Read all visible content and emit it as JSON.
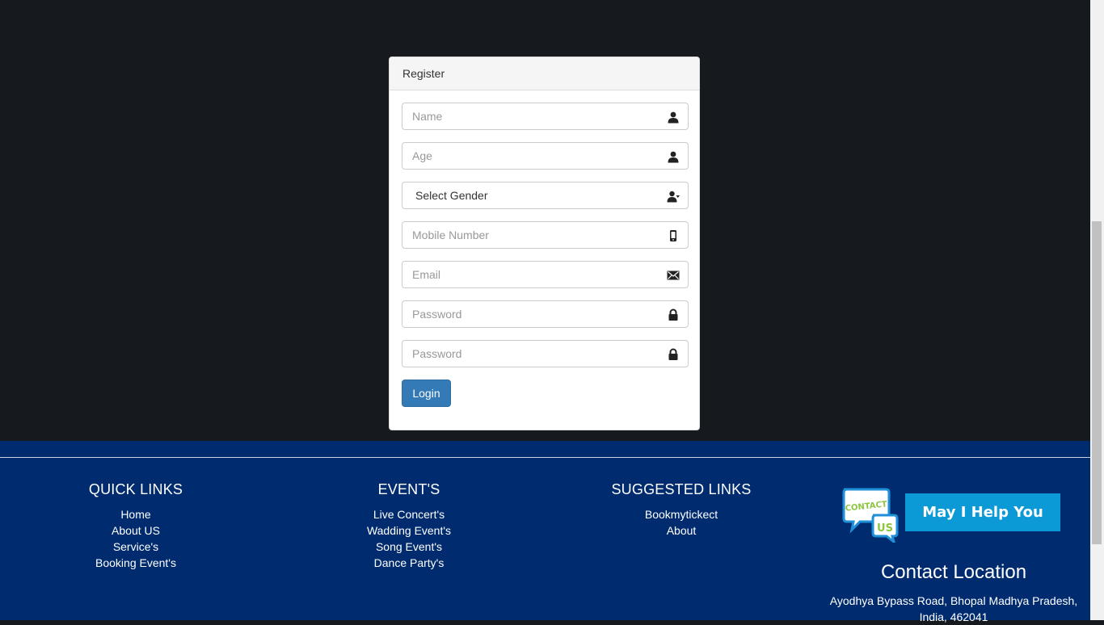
{
  "register": {
    "heading": "Register",
    "fields": {
      "name_placeholder": "Name",
      "age_placeholder": "Age",
      "gender_selected": "Select Gender",
      "mobile_placeholder": "Mobile Number",
      "email_placeholder": "Email",
      "password_placeholder": "Password",
      "confirm_password_placeholder": "Password"
    },
    "login_label": "Login"
  },
  "footer": {
    "quick_links": {
      "title": "QUICK LINKS",
      "items": [
        "Home",
        "About US",
        "Service's",
        "Booking Event's"
      ]
    },
    "events": {
      "title": "EVENT'S",
      "items": [
        "Live Concert's",
        "Wadding Event's",
        "Song Event's",
        "Dance Party's"
      ]
    },
    "suggested": {
      "title": "SUGGESTED LINKS",
      "items": [
        "Bookmytickect",
        "About"
      ]
    },
    "contact_logo": {
      "top": "CONTACT",
      "bottom": "US"
    },
    "help_label": "May I Help You",
    "contact_title": "Contact Location",
    "address": "Ayodhya Bypass Road, Bhopal Madhya Pradesh, India, 462041"
  },
  "colors": {
    "page_bg": "#16191d",
    "footer_bg": "#002c6f",
    "primary_button": "#337ab7",
    "help_button": "#0b9ad6"
  }
}
